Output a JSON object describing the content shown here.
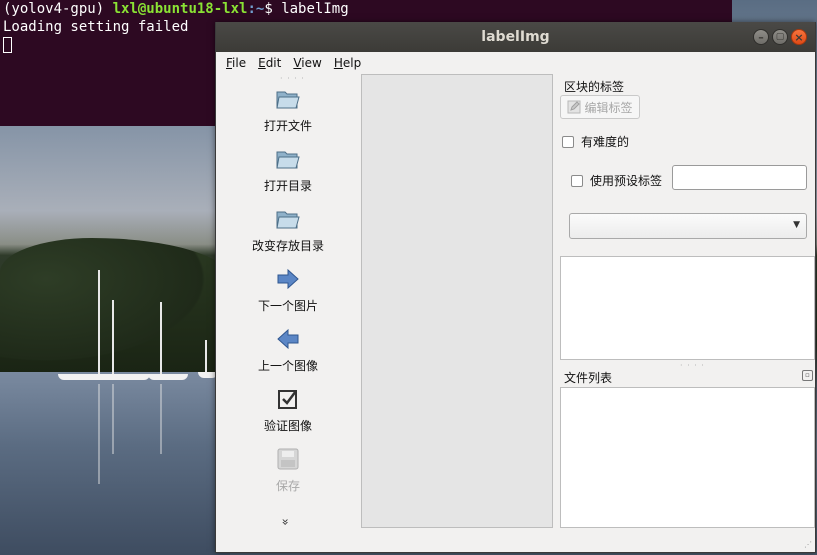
{
  "terminal": {
    "env": "(yolov4-gpu)",
    "user_host": "lxl@ubuntu18-lxl",
    "path": ":~",
    "dollar": "$",
    "command": "labelImg",
    "output": "Loading setting failed"
  },
  "window": {
    "title": "labelImg",
    "minimize_glyph": "–",
    "maximize_glyph": "▢",
    "close_glyph": "×"
  },
  "menu": {
    "items": [
      {
        "key": "F",
        "rest": "ile"
      },
      {
        "key": "E",
        "rest": "dit"
      },
      {
        "key": "V",
        "rest": "iew"
      },
      {
        "key": "H",
        "rest": "elp"
      }
    ]
  },
  "toolbar": {
    "open_file": "打开文件",
    "open_dir": "打开目录",
    "change_save_dir": "改变存放目录",
    "next_image": "下一个图片",
    "prev_image": "上一个图像",
    "verify_image": "验证图像",
    "save": "保存",
    "more_glyph": "»"
  },
  "dock": {
    "box_labels_title": "区块的标签",
    "edit_label_button": "编辑标签",
    "difficult_label": "有难度的",
    "use_default_label": "使用预设标签",
    "default_label_value": "",
    "combo_value": "",
    "file_list_title": "文件列表"
  },
  "icons": {
    "folder": "folder-icon",
    "next": "arrow-right-icon",
    "prev": "arrow-left-icon",
    "verify": "checkbox-icon",
    "save": "floppy-disk-icon",
    "edit": "pencil-icon"
  },
  "colors": {
    "terminal_bg": "#2d0922",
    "prompt_green": "#8ae234",
    "prompt_blue": "#729fcf",
    "titlebar": "#3c3b37",
    "close_orange": "#df4a16",
    "window_bg": "#f2f1f0"
  }
}
